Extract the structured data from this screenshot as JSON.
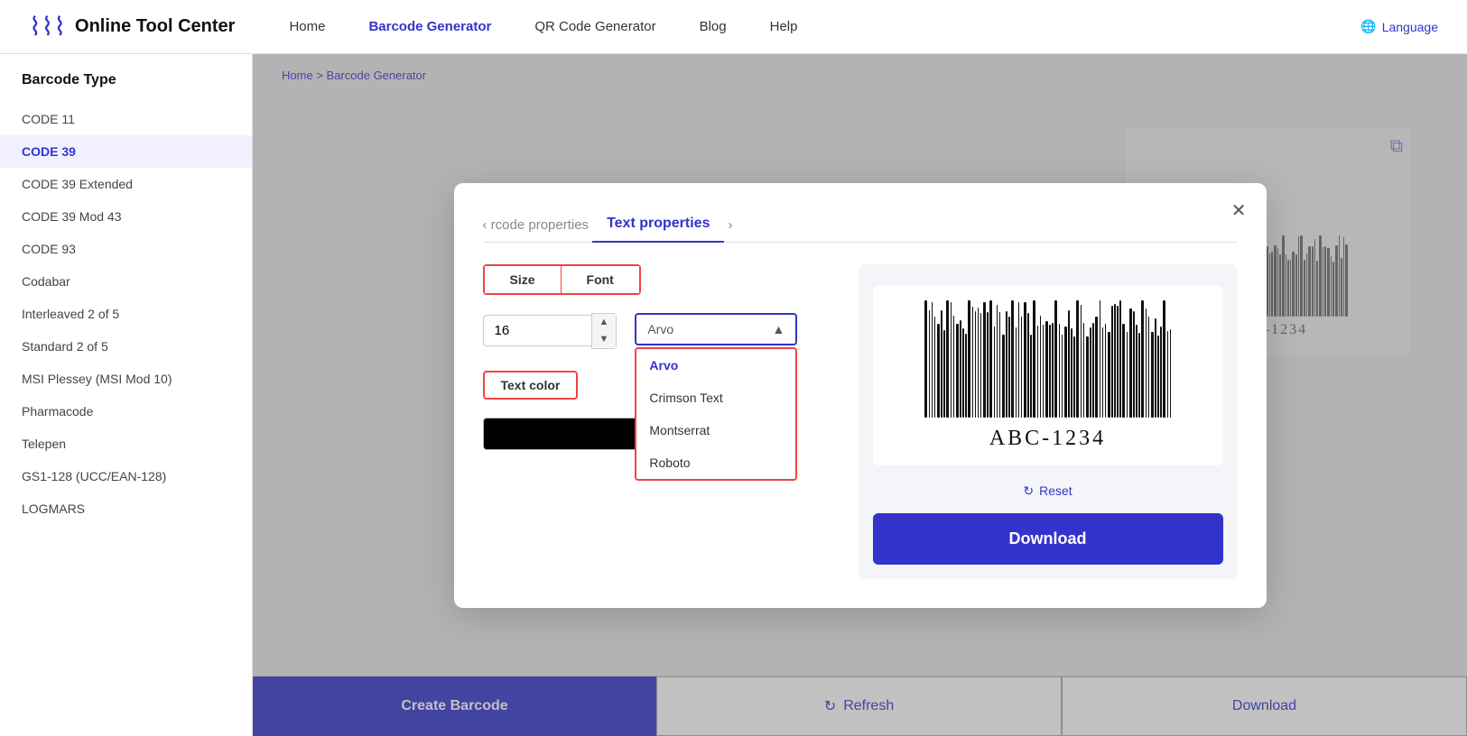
{
  "nav": {
    "logo_icon": "▌▌▌▌▌",
    "logo_text": "Online Tool Center",
    "links": [
      {
        "label": "Home",
        "active": false
      },
      {
        "label": "Barcode Generator",
        "active": true
      },
      {
        "label": "QR Code Generator",
        "active": false
      },
      {
        "label": "Blog",
        "active": false
      },
      {
        "label": "Help",
        "active": false
      }
    ],
    "language_label": "Language"
  },
  "sidebar": {
    "title": "Barcode Type",
    "items": [
      {
        "label": "CODE 11",
        "active": false
      },
      {
        "label": "CODE 39",
        "active": true
      },
      {
        "label": "CODE 39 Extended",
        "active": false
      },
      {
        "label": "CODE 39 Mod 43",
        "active": false
      },
      {
        "label": "CODE 93",
        "active": false
      },
      {
        "label": "Codabar",
        "active": false
      },
      {
        "label": "Interleaved 2 of 5",
        "active": false
      },
      {
        "label": "Standard 2 of 5",
        "active": false
      },
      {
        "label": "MSI Plessey (MSI Mod 10)",
        "active": false
      },
      {
        "label": "Pharmacode",
        "active": false
      },
      {
        "label": "Telepen",
        "active": false
      },
      {
        "label": "GS1-128 (UCC/EAN-128)",
        "active": false
      },
      {
        "label": "LOGMARS",
        "active": false
      }
    ]
  },
  "breadcrumb": {
    "home": "Home",
    "separator": ">",
    "current": "Barcode Generator"
  },
  "modal": {
    "tab_prev": "‹ rcode properties",
    "tab_active": "Text properties",
    "tab_next": "›",
    "close": "✕",
    "sub_tabs": [
      "Size",
      "Font"
    ],
    "active_sub_tab": "Size",
    "size_value": "16",
    "font_label": "Arvo",
    "font_options": [
      "Arvo",
      "Crimson Text",
      "Montserrat",
      "Roboto"
    ],
    "selected_font": "Arvo",
    "text_color_label": "Text color",
    "barcode_text": "ABC-1234",
    "reset_label": "Reset",
    "download_label": "Download"
  },
  "bottom_buttons": {
    "create": "Create Barcode",
    "refresh_icon": "↻",
    "refresh": "Refresh",
    "download": "Download"
  }
}
